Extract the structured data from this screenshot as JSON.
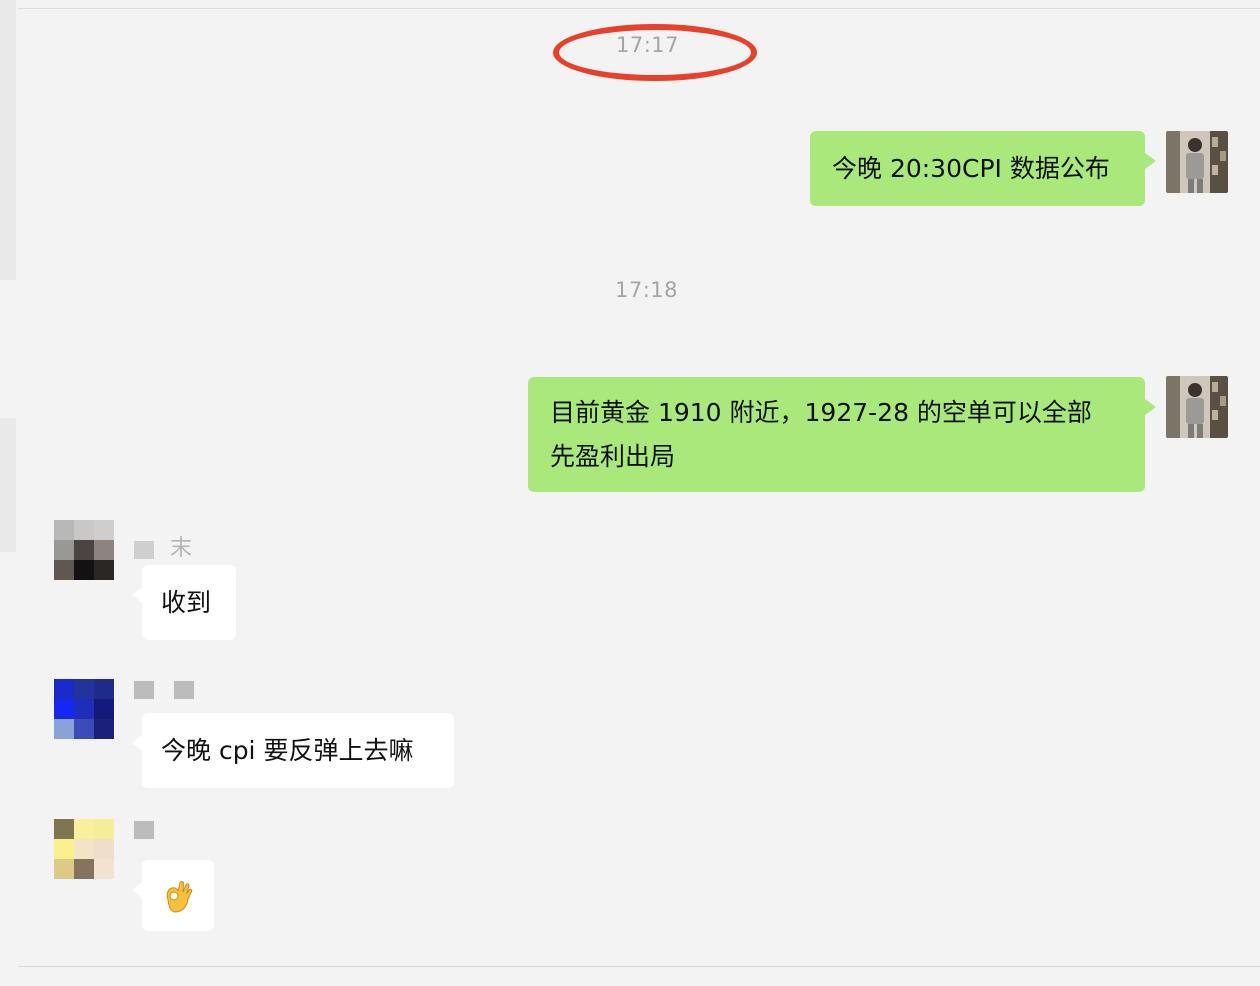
{
  "timestamps": [
    "17:17",
    "17:18"
  ],
  "messages": [
    {
      "direction": "out",
      "text": "今晚 20:30CPI 数据公布"
    },
    {
      "direction": "out",
      "lines": [
        "目前黄金 1910 附近，1927-28 的空单可以全部",
        "先盈利出局"
      ]
    },
    {
      "direction": "in",
      "sender_name_visible": "末",
      "text": "收到"
    },
    {
      "direction": "in",
      "text": "今晚 cpi 要反弹上去嘛"
    },
    {
      "direction": "in",
      "emoji": "ok-hand-emoji"
    }
  ],
  "colors": {
    "background": "#f3f3f3",
    "outgoing_bubble": "#a9e97b",
    "incoming_bubble": "#ffffff",
    "timestamp": "#a5a5a5",
    "annotation_circle": "#e8412b"
  }
}
